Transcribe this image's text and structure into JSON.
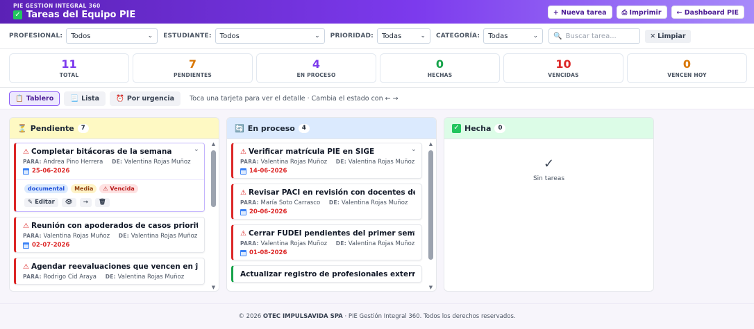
{
  "header": {
    "org": "PIE GESTIÓN INTEGRAL 360",
    "title": "Tareas del Equipo PIE",
    "buttons": {
      "new_task": "+ Nueva tarea",
      "print": "Imprimir",
      "dashboard": "← Dashboard PIE"
    }
  },
  "filters": {
    "profesional": {
      "label": "PROFESIONAL:",
      "value": "Todos"
    },
    "estudiante": {
      "label": "ESTUDIANTE:",
      "value": "Todos"
    },
    "prioridad": {
      "label": "PRIORIDAD:",
      "value": "Todas"
    },
    "categoria": {
      "label": "CATEGORÍA:",
      "value": "Todas"
    },
    "search_placeholder": "Buscar tarea...",
    "clear_label": "Limpiar"
  },
  "stats": [
    {
      "value": "11",
      "label": "TOTAL",
      "color": "#7c3aed"
    },
    {
      "value": "7",
      "label": "PENDIENTES",
      "color": "#d97706"
    },
    {
      "value": "4",
      "label": "EN PROCESO",
      "color": "#7c3aed"
    },
    {
      "value": "0",
      "label": "HECHAS",
      "color": "#16a34a"
    },
    {
      "value": "10",
      "label": "VENCIDAS",
      "color": "#dc2626"
    },
    {
      "value": "0",
      "label": "VENCEN HOY",
      "color": "#d97706"
    }
  ],
  "views": {
    "board": "Tablero",
    "list": "Lista",
    "urgency": "Por urgencia",
    "hint": "Toca una tarjeta para ver el detalle · Cambia el estado con ← →"
  },
  "columns": {
    "pending": {
      "title": "Pendiente",
      "count": "7",
      "color": "#fef9c3",
      "cards": [
        {
          "title": "Completar bitácoras de la semana",
          "to_label": "PARA:",
          "to": "Andrea Pino Herrera",
          "from_label": "DE:",
          "from": "Valentina Rojas Muñoz",
          "date": "25-06-2026",
          "tags": [
            "documental",
            "Media",
            "⚠ Vencida"
          ],
          "actions": [
            "✎ Editar",
            "👁",
            "→",
            "🗑"
          ]
        },
        {
          "title": "Reunión con apoderados de casos prioritarios",
          "to_label": "PARA:",
          "to": "Valentina Rojas Muñoz",
          "from_label": "DE:",
          "from": "Valentina Rojas Muñoz",
          "date": "02-07-2026"
        },
        {
          "title": "Agendar reevaluaciones que vencen en julio",
          "to_label": "PARA:",
          "to": "Rodrigo Cid Araya",
          "from_label": "DE:",
          "from": "Valentina Rojas Muñoz",
          "date": ""
        }
      ]
    },
    "in_progress": {
      "title": "En proceso",
      "count": "4",
      "color": "#dbeafe",
      "cards": [
        {
          "title": "Verificar matrícula PIE en SIGE",
          "to_label": "PARA:",
          "to": "Valentina Rojas Muñoz",
          "from_label": "DE:",
          "from": "Valentina Rojas Muñoz",
          "date": "14-06-2026"
        },
        {
          "title": "Revisar PACI en revisión con docentes de aula",
          "to_label": "PARA:",
          "to": "María Soto Carrasco",
          "from_label": "DE:",
          "from": "Valentina Rojas Muñoz",
          "date": "20-06-2026"
        },
        {
          "title": "Cerrar FUDEI pendientes del primer semestre",
          "to_label": "PARA:",
          "to": "Valentina Rojas Muñoz",
          "from_label": "DE:",
          "from": "Valentina Rojas Muñoz",
          "date": "01-08-2026"
        },
        {
          "title": "Actualizar registro de profesionales externos"
        }
      ]
    },
    "done": {
      "title": "Hecha",
      "count": "0",
      "color": "#dcfce7",
      "empty_icon": "✓",
      "empty_text": "Sin tareas"
    }
  },
  "footer": {
    "prefix": "© 2026",
    "company": "OTEC IMPULSAVIDA SPA",
    "suffix": "· PIE Gestión Integral 360. Todos los derechos reservados."
  }
}
